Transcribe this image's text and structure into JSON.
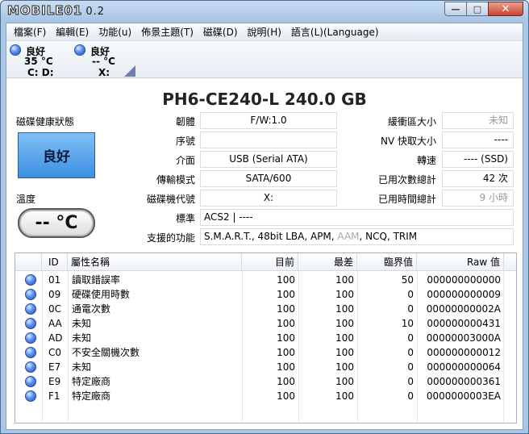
{
  "window": {
    "logo": "MOBILE01",
    "version_suffix": "0.2",
    "controls": {
      "minimize": "—",
      "maximize": "□",
      "close": "✕"
    }
  },
  "menu": [
    "檔案(F)",
    "編輯(E)",
    "功能(u)",
    "佈景主題(T)",
    "磁碟(D)",
    "說明(H)",
    "語言(L)(Language)"
  ],
  "drives": [
    {
      "status": "良好",
      "temp": "35 °C",
      "letters": "C: D:"
    },
    {
      "status": "良好",
      "temp": "-- °C",
      "letters": "X:"
    }
  ],
  "model": "PH6-CE240-L  240.0 GB",
  "health": {
    "label": "磁碟健康狀態",
    "value": "良好"
  },
  "temperature": {
    "label": "溫度",
    "value": "-- °C"
  },
  "info": {
    "firmware_label": "韌體",
    "firmware": "F/W:1.0",
    "serial_label": "序號",
    "serial": "",
    "interface_label": "介面",
    "interface": "USB (Serial ATA)",
    "transfer_label": "傳輸模式",
    "transfer": "SATA/600",
    "drive_letter_label": "磁碟機代號",
    "drive_letter": "X:",
    "standard_label": "標準",
    "standard": "ACS2 | ----",
    "features_label": "支援的功能",
    "features_part1": "S.M.A.R.T., 48bit LBA, APM, ",
    "features_dim": "AAM",
    "features_part2": ", NCQ, TRIM",
    "buffer_label": "緩衝區大小",
    "buffer": "未知",
    "nv_cache_label": "NV 快取大小",
    "nv_cache": "----",
    "rotation_label": "轉速",
    "rotation": "---- (SSD)",
    "power_on_count_label": "已用次數總計",
    "power_on_count": "42 次",
    "power_on_hours_label": "已用時間總計",
    "power_on_hours": "9 小時"
  },
  "smart": {
    "headers": {
      "id": "ID",
      "name": "屬性名稱",
      "current": "目前",
      "worst": "最差",
      "threshold": "臨界值",
      "raw": "Raw 值"
    },
    "rows": [
      {
        "id": "01",
        "name": "讀取錯誤率",
        "current": "100",
        "worst": "100",
        "threshold": "50",
        "raw": "000000000000"
      },
      {
        "id": "09",
        "name": "硬碟使用時數",
        "current": "100",
        "worst": "100",
        "threshold": "0",
        "raw": "000000000009"
      },
      {
        "id": "0C",
        "name": "通電次數",
        "current": "100",
        "worst": "100",
        "threshold": "0",
        "raw": "00000000002A"
      },
      {
        "id": "AA",
        "name": "未知",
        "current": "100",
        "worst": "100",
        "threshold": "10",
        "raw": "000000000431"
      },
      {
        "id": "AD",
        "name": "未知",
        "current": "100",
        "worst": "100",
        "threshold": "0",
        "raw": "00000003000A"
      },
      {
        "id": "C0",
        "name": "不安全關機次數",
        "current": "100",
        "worst": "100",
        "threshold": "0",
        "raw": "000000000012"
      },
      {
        "id": "E7",
        "name": "未知",
        "current": "100",
        "worst": "100",
        "threshold": "0",
        "raw": "000000000064"
      },
      {
        "id": "E9",
        "name": "特定廠商",
        "current": "100",
        "worst": "100",
        "threshold": "0",
        "raw": "000000000361"
      },
      {
        "id": "F1",
        "name": "特定廠商",
        "current": "100",
        "worst": "100",
        "threshold": "0",
        "raw": "0000000003EA"
      }
    ]
  }
}
